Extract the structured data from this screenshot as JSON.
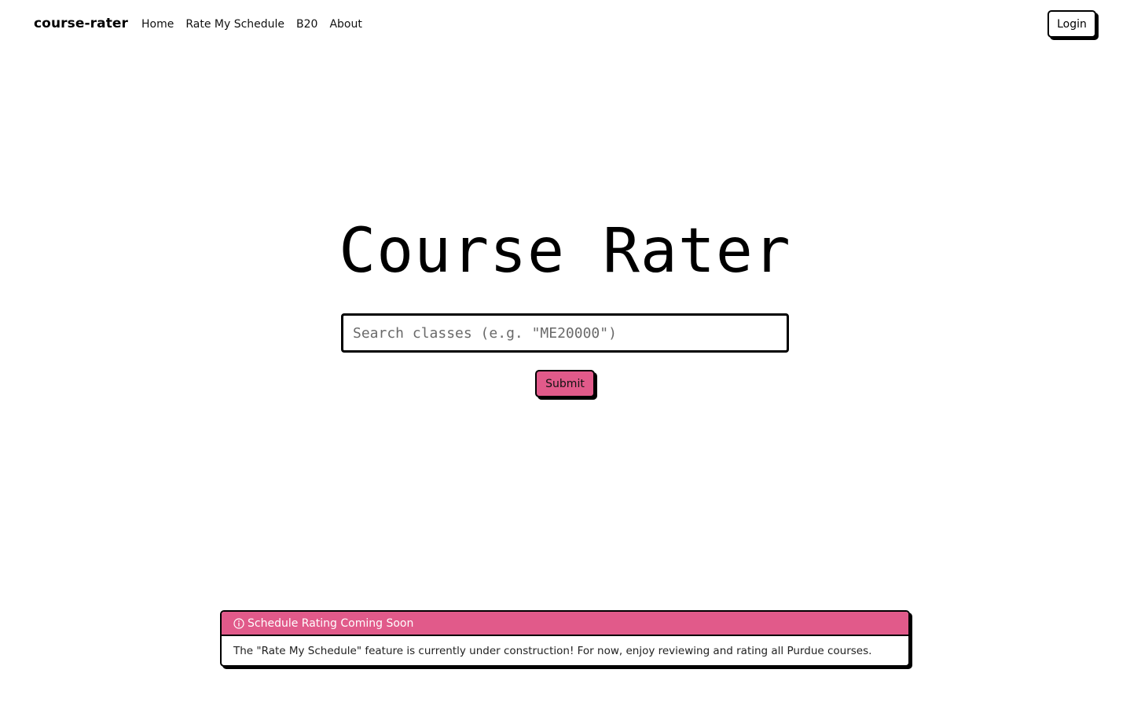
{
  "navbar": {
    "brand": "course-rater",
    "links": [
      {
        "label": "Home"
      },
      {
        "label": "Rate My Schedule"
      },
      {
        "label": "B20"
      },
      {
        "label": "About"
      }
    ],
    "login_label": "Login"
  },
  "hero": {
    "title": "Course Rater",
    "search": {
      "placeholder": "Search classes (e.g. \"ME20000\")",
      "value": ""
    },
    "submit_label": "Submit"
  },
  "alert": {
    "icon": "info-icon",
    "title": "Schedule Rating Coming Soon",
    "message": "The \"Rate My Schedule\" feature is currently under construction! For now, enjoy reviewing and rating all Purdue courses."
  },
  "colors": {
    "accent": "#e15a8a",
    "border": "#000000",
    "background": "#ffffff"
  }
}
